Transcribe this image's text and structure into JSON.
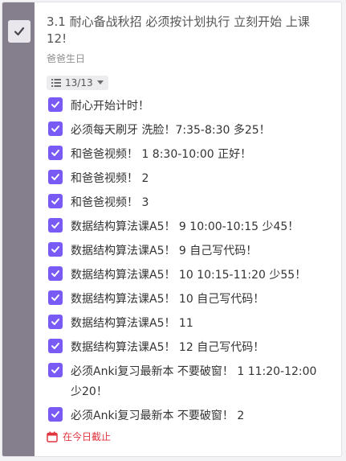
{
  "task": {
    "title": "3.1 耐心备战秋招 必须按计划执行 立刻开始 上课12!",
    "subtitle": "爸爸生日",
    "progress": "13/13",
    "due": "在今日截止"
  },
  "colors": {
    "rail": "#857e8d",
    "checkbox": "#7a5af5",
    "due": "#e0353f"
  },
  "checklist": [
    {
      "text": "耐心开始计时！",
      "checked": true
    },
    {
      "text": "必须每天刷牙 洗脸！7:35-8:30 多25！",
      "checked": true
    },
    {
      "text": "和爸爸视频！ 1 8:30-10:00 正好！",
      "checked": true
    },
    {
      "text": "和爸爸视频！ 2",
      "checked": true
    },
    {
      "text": "和爸爸视频！ 3",
      "checked": true
    },
    {
      "text": "数据结构算法课A5！ 9 10:00-10:15 少45！",
      "checked": true
    },
    {
      "text": "数据结构算法课A5！ 9 自己写代码！",
      "checked": true
    },
    {
      "text": "数据结构算法课A5！ 10 10:15-11:20 少55！",
      "checked": true
    },
    {
      "text": "数据结构算法课A5！ 10 自己写代码！",
      "checked": true
    },
    {
      "text": "数据结构算法课A5！ 11",
      "checked": true
    },
    {
      "text": "数据结构算法课A5！ 12 自己写代码！",
      "checked": true
    },
    {
      "text": "必须Anki复习最新本 不要破窗！ 1 11:20-12:00 少20！",
      "checked": true
    },
    {
      "text": "必须Anki复习最新本 不要破窗！ 2",
      "checked": true
    }
  ]
}
